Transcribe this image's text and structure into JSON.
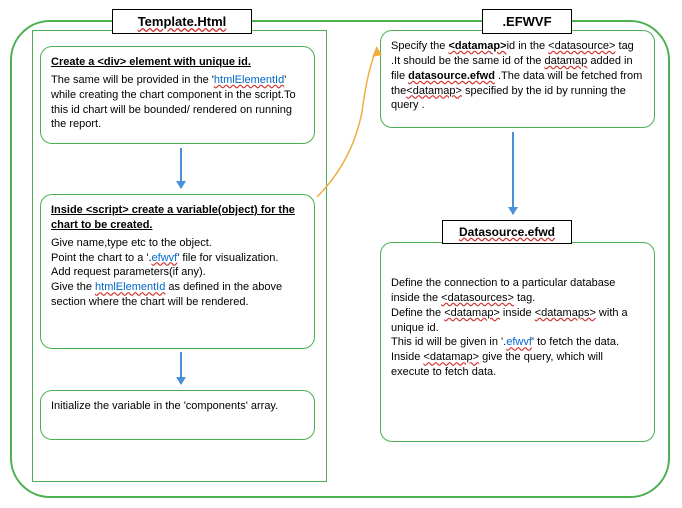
{
  "titles": {
    "template": "Template.Html",
    "efwvf": ".EFWVF",
    "datasource": "Datasource.efwd"
  },
  "box1": {
    "title": "Create a <div> element with unique id.",
    "body_part1": "The same will be provided in the '",
    "body_link": "htmlElementId",
    "body_part2": "' while creating the chart component in the script.To this id chart will be bounded/ rendered on running the report."
  },
  "box2": {
    "title": "Inside <script> create a variable(object) for the chart to be created.",
    "line1": "Give name,type etc to the object.",
    "line2a": "Point the chart to a '.",
    "line2link": "efwvf",
    "line2b": "' file for visualization.",
    "line3": "Add request parameters(if any).",
    "line4a": "Give the ",
    "line4link": "htmlElementId",
    "line4b": " as defined in the above section where the chart will be rendered."
  },
  "box3": {
    "text": "Initialize the variable in the 'components' array."
  },
  "box4": {
    "p1a": "Specify the ",
    "p1b": "<datamap>",
    "p1c": "id in the ",
    "p1d": "<datasource>",
    "p2a": " tag .It should be the same id of the ",
    "p2b": "datamap",
    "p2c": " added in file ",
    "p2d": "datasource.efwd",
    "p2e": " .The data will be fetched from the",
    "p2f": "<datamap>",
    "p2g": " specified by the id by running the query ."
  },
  "box5": {
    "l1a": "Define the connection to a particular database inside the ",
    "l1b": "<datasources>",
    "l1c": " tag.",
    "l2a": "Define the ",
    "l2b": "<datamap>",
    "l2c": " inside ",
    "l2d": "<datamaps>",
    "l2e": " with a unique id.",
    "l3a": "This id will be given in '.",
    "l3b": "efwvf",
    "l3c": "' to fetch the data.",
    "l4a": "Inside ",
    "l4b": "<datamap>",
    "l4c": " give the query, which will execute to fetch data."
  }
}
